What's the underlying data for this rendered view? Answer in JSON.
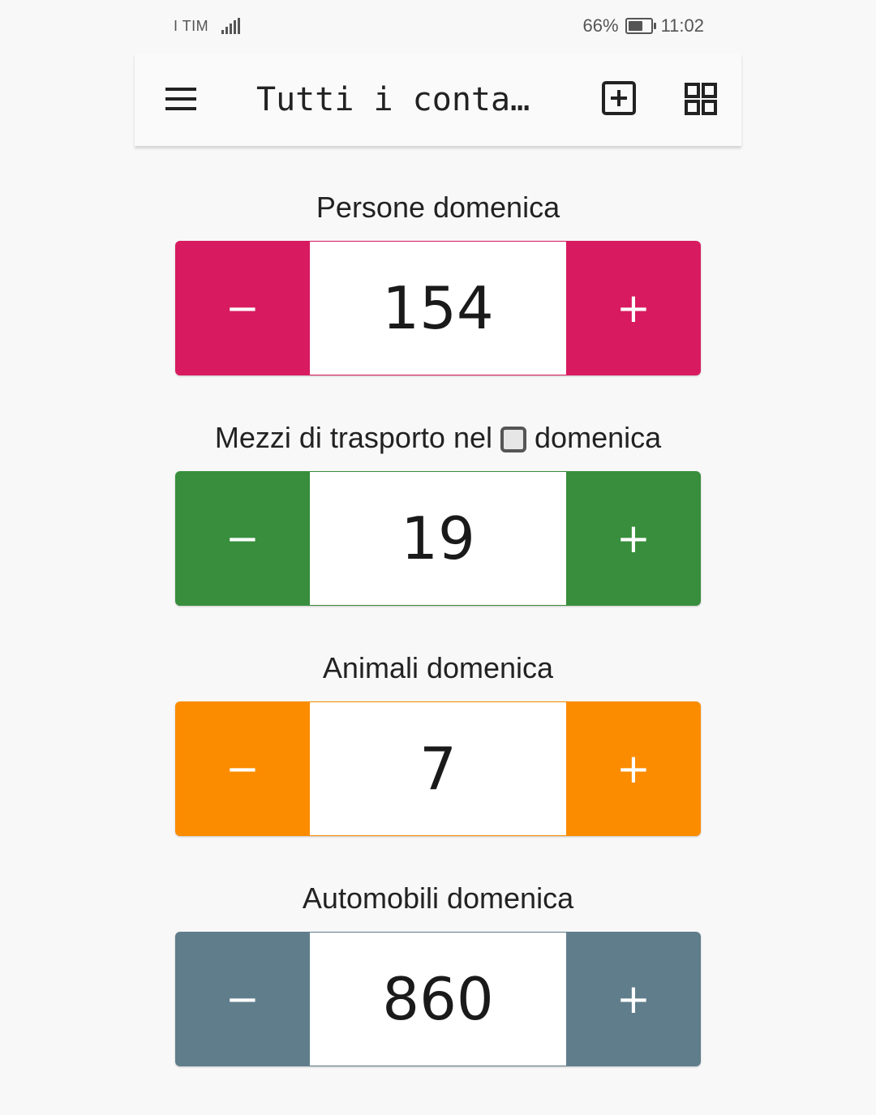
{
  "status_bar": {
    "carrier": "I TIM",
    "battery_percent": "66%",
    "battery_level": 0.66,
    "time": "11:02"
  },
  "app_bar": {
    "title": "Tutti i conta…",
    "menu_icon": "hamburger-menu-icon",
    "add_icon": "add-box-icon",
    "grid_icon": "grid-view-icon"
  },
  "counters": [
    {
      "name": "Persone domenica",
      "value": "154",
      "color": "#d81b60",
      "minus_label": "−",
      "plus_label": "+"
    },
    {
      "name_before": "Mezzi di trasporto nel",
      "name_after": "domenica",
      "value": "19",
      "color": "#388e3c",
      "minus_label": "−",
      "plus_label": "+"
    },
    {
      "name": "Animali domenica",
      "value": "7",
      "color": "#fb8c00",
      "minus_label": "−",
      "plus_label": "+"
    },
    {
      "name": "Automobili domenica",
      "value": "860",
      "color": "#607d8b",
      "minus_label": "−",
      "plus_label": "+"
    }
  ]
}
